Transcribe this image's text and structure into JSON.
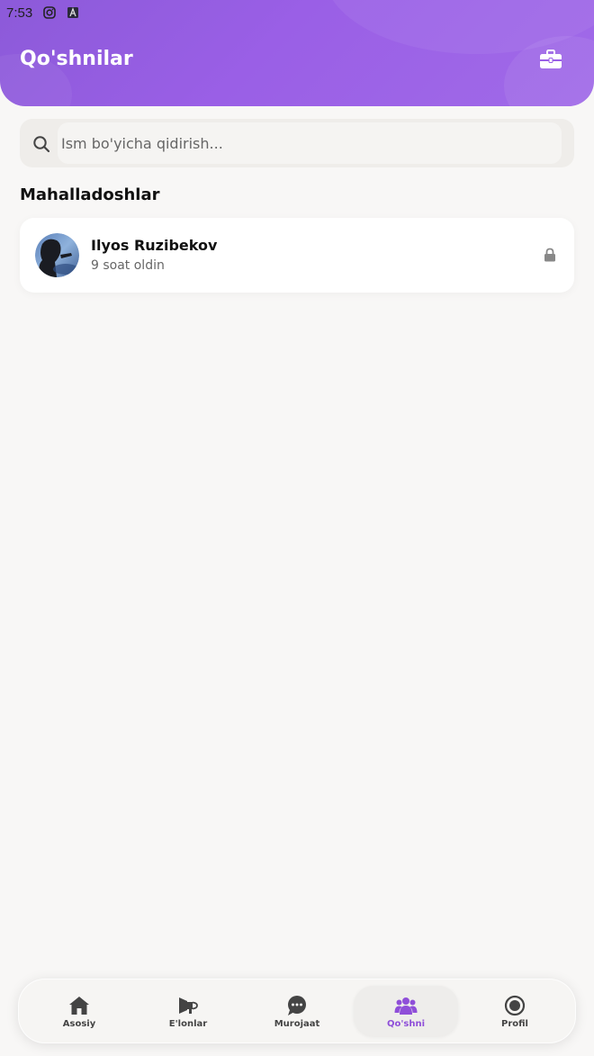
{
  "status_bar": {
    "time": "7:53"
  },
  "header": {
    "title": "Qo'shnilar"
  },
  "search": {
    "placeholder": "Ism bo'yicha qidirish..."
  },
  "section": {
    "title": "Mahalladoshlar"
  },
  "neighbors": [
    {
      "name": "Ilyos Ruzibekov",
      "time": "9 soat oldin",
      "status_icon": "lock-icon"
    }
  ],
  "bottom_nav": {
    "items": [
      {
        "label": "Asosiy",
        "icon": "home-icon"
      },
      {
        "label": "E'lonlar",
        "icon": "megaphone-icon"
      },
      {
        "label": "Murojaat",
        "icon": "chat-icon"
      },
      {
        "label": "Qo'shni",
        "icon": "neighbors-icon",
        "active": true
      },
      {
        "label": "Profil",
        "icon": "profile-icon"
      }
    ]
  },
  "colors": {
    "accent": "#8f4fd9",
    "header": "#9a5fe6",
    "background": "#f8f7f6"
  }
}
